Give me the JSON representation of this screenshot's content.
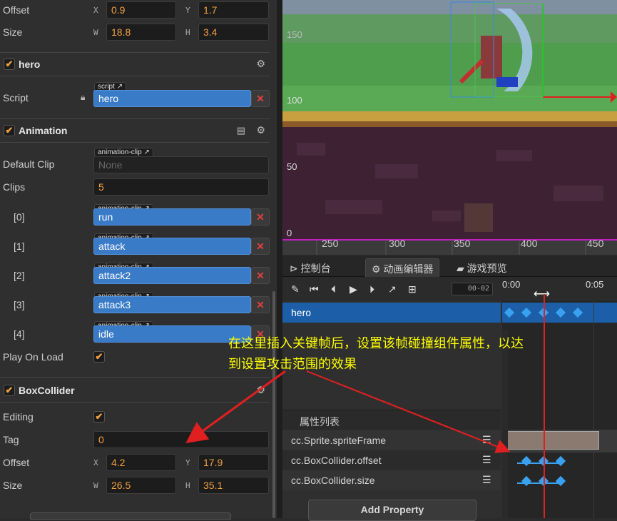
{
  "inspector": {
    "offset_row": {
      "label": "Offset",
      "x_axis": "X",
      "x_value": "0.9",
      "y_axis": "Y",
      "y_value": "1.7"
    },
    "size_row": {
      "label": "Size",
      "w_axis": "W",
      "w_value": "18.8",
      "h_axis": "H",
      "h_value": "3.4"
    },
    "hero_component": {
      "title": "hero",
      "script_label": "Script",
      "script_tag": "script",
      "script_value": "hero"
    },
    "animation_component": {
      "title": "Animation",
      "default_clip_label": "Default Clip",
      "default_clip_tag": "animation-clip",
      "default_clip_value": "None",
      "clips_label": "Clips",
      "clips_count": "5",
      "clip_tag": "animation-clip",
      "clips": [
        {
          "index": "[0]",
          "value": "run"
        },
        {
          "index": "[1]",
          "value": "attack"
        },
        {
          "index": "[2]",
          "value": "attack2"
        },
        {
          "index": "[3]",
          "value": "attack3"
        },
        {
          "index": "[4]",
          "value": "idle"
        }
      ],
      "play_on_load_label": "Play On Load"
    },
    "boxcollider_component": {
      "title": "BoxCollider",
      "editing_label": "Editing",
      "tag_label": "Tag",
      "tag_value": "0",
      "offset_label": "Offset",
      "offset_x_axis": "X",
      "offset_x": "4.2",
      "offset_y_axis": "Y",
      "offset_y": "17.9",
      "size_label": "Size",
      "size_w_axis": "W",
      "size_w": "26.5",
      "size_h_axis": "H",
      "size_h": "35.1"
    }
  },
  "scene": {
    "y_labels": [
      "150",
      "100",
      "50",
      "0"
    ],
    "x_labels": [
      "250",
      "300",
      "350",
      "400",
      "450"
    ]
  },
  "tabs": [
    {
      "label": "控制台",
      "icon": "console-icon"
    },
    {
      "label": "动画编辑器",
      "icon": "animation-editor-icon"
    },
    {
      "label": "游戏预览",
      "icon": "game-preview-icon"
    }
  ],
  "anim_editor": {
    "frame_value": "00-02",
    "time_start": "0:00",
    "time_end": "0:05",
    "node_name": "hero",
    "property_list_label": "属性列表",
    "properties": [
      "cc.Sprite.spriteFrame",
      "cc.BoxCollider.offset",
      "cc.BoxCollider.size"
    ],
    "add_property_label": "Add Property"
  },
  "annotation": {
    "line1": "在这里插入关键帧后，设置该帧碰撞组件属性，以达",
    "line2": "到设置攻击范围的效果",
    "color": "#ffff00"
  },
  "colors": {
    "accent_blue": "#3a7bc8",
    "keyframe": "#3aa0f0",
    "playhead": "#e02020",
    "arrow": "#e02020"
  }
}
